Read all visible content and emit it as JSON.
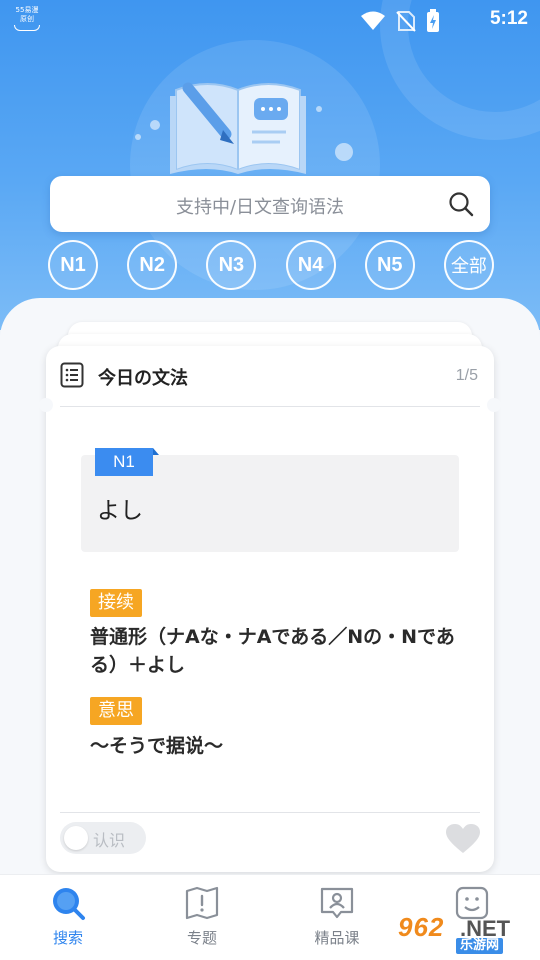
{
  "status_bar": {
    "logo_line1": "55易漫",
    "logo_line2": "原创",
    "time": "5:12"
  },
  "search": {
    "placeholder": "支持中/日文查询语法"
  },
  "levels": [
    "N1",
    "N2",
    "N3",
    "N4",
    "N5",
    "全部"
  ],
  "card": {
    "title": "今日の文法",
    "page": "1/5",
    "level_tag": "N1",
    "word": "よし",
    "connection_label": "接续",
    "connection_text": "普通形（ナAな・ナAである／Nの・Nである）＋よし",
    "meaning_label": "意思",
    "meaning_text": "～そうで据说～",
    "know_label": "认识"
  },
  "nav": {
    "items": [
      {
        "label": "搜索",
        "icon": "search-icon"
      },
      {
        "label": "专题",
        "icon": "map-icon"
      },
      {
        "label": "精品课",
        "icon": "course-icon"
      },
      {
        "label": "",
        "icon": "profile-icon"
      }
    ]
  },
  "watermark": {
    "num": "962",
    "net": ".NET",
    "cn": "乐游网"
  },
  "colors": {
    "primary": "#3f96f0",
    "chip": "#f6a623",
    "tag": "#3b8cf0"
  }
}
